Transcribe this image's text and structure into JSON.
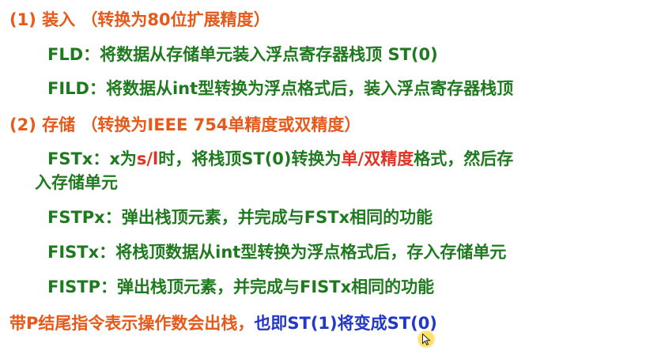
{
  "section1": {
    "heading": "(1) 装入",
    "heading_note": "（转换为80位扩展精度）",
    "items": [
      {
        "text": "FLD：将数据从存储单元装入浮点寄存器栈顶 ST(0)"
      },
      {
        "text": "FILD：将数据从int型转换为浮点格式后，装入浮点寄存器栈顶"
      }
    ]
  },
  "section2": {
    "heading": "(2) 存储",
    "heading_note": "（转换为IEEE 754单精度或双精度）",
    "fstx": {
      "part1": "FSTx：x为",
      "highlight1": "s/l",
      "part2": "时，将栈顶ST(0)转换为",
      "highlight2": "单/双精度",
      "part3": "格式，然后存",
      "continuation": "入存储单元"
    },
    "items": [
      {
        "text": "FSTPx：弹出栈顶元素，并完成与FSTx相同的功能"
      },
      {
        "text": "FISTx：将栈顶数据从int型转换为浮点格式后，存入存储单元"
      },
      {
        "text": "FISTP：弹出栈顶元素，并完成与FISTx相同的功能"
      }
    ]
  },
  "note": {
    "part1": "带P结尾指令表示操作数会出栈，",
    "part2": "也即ST(1)将变成ST(0)"
  },
  "colors": {
    "heading": "#e5591a",
    "body": "#1f7a1f",
    "highlight": "#e03324",
    "note_emphasis": "#2438c8"
  },
  "icons": {
    "cursor": "mouse-pointer-icon"
  }
}
